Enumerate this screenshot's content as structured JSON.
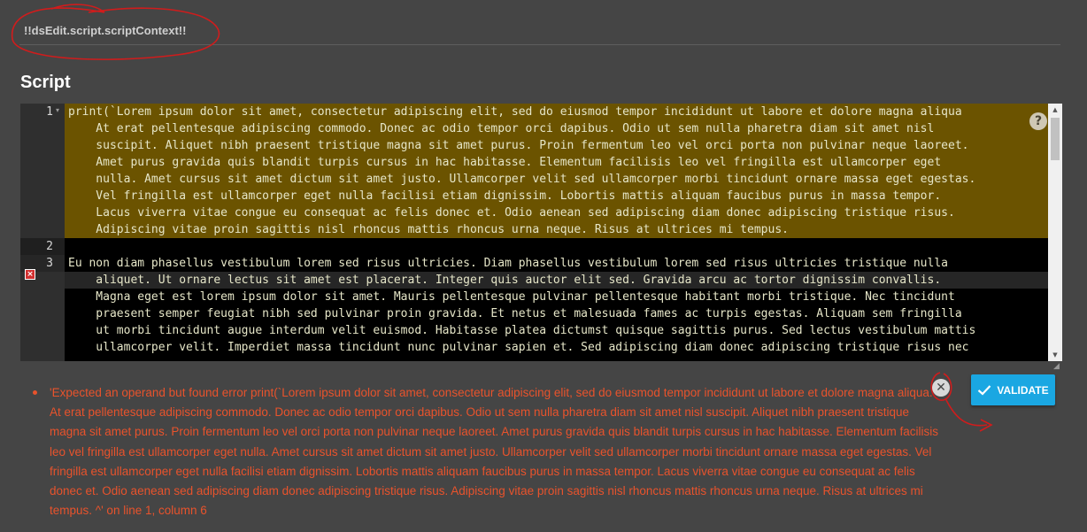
{
  "header": {
    "context": "!!dsEdit.script.scriptContext!!"
  },
  "section": {
    "title": "Script"
  },
  "editor": {
    "line_numbers": [
      "1",
      "2",
      "3"
    ],
    "lines": [
      "print(`Lorem ipsum dolor sit amet, consectetur adipiscing elit, sed do eiusmod tempor incididunt ut labore et dolore magna aliqua\n    At erat pellentesque adipiscing commodo. Donec ac odio tempor orci dapibus. Odio ut sem nulla pharetra diam sit amet nisl\n    suscipit. Aliquet nibh praesent tristique magna sit amet purus. Proin fermentum leo vel orci porta non pulvinar neque laoreet.\n    Amet purus gravida quis blandit turpis cursus in hac habitasse. Elementum facilisis leo vel fringilla est ullamcorper eget\n    nulla. Amet cursus sit amet dictum sit amet justo. Ullamcorper velit sed ullamcorper morbi tincidunt ornare massa eget egestas.\n    Vel fringilla est ullamcorper eget nulla facilisi etiam dignissim. Lobortis mattis aliquam faucibus purus in massa tempor.\n    Lacus viverra vitae congue eu consequat ac felis donec et. Odio aenean sed adipiscing diam donec adipiscing tristique risus.\n    Adipiscing vitae proin sagittis nisl rhoncus mattis rhoncus urna neque. Risus at ultrices mi tempus.",
      "",
      "Eu non diam phasellus vestibulum lorem sed risus ultricies. Diam phasellus vestibulum lorem sed risus ultricies tristique nulla\n    aliquet. Ut ornare lectus sit amet est placerat. Integer quis auctor elit sed. Gravida arcu ac tortor dignissim convallis.\n    Magna eget est lorem ipsum dolor sit amet. Mauris pellentesque pulvinar pellentesque habitant morbi tristique. Nec tincidunt\n    praesent semper feugiat nibh sed pulvinar proin gravida. Et netus et malesuada fames ac turpis egestas. Aliquam sem fringilla\n    ut morbi tincidunt augue interdum velit euismod. Habitasse platea dictumst quisque sagittis purus. Sed lectus vestibulum mattis\n    ullamcorper velit. Imperdiet massa tincidunt nunc pulvinar sapien et. Sed adipiscing diam donec adipiscing tristique risus nec"
    ],
    "fold_glyph": "▾",
    "error_marker": "×",
    "help_glyph": "?",
    "colors": {
      "error_highlight": "#6b5300",
      "gutter": "#2f2f2f",
      "background": "#000000"
    }
  },
  "errors": {
    "items": [
      "'Expected an operand but found error print(`Lorem ipsum dolor sit amet, consectetur adipiscing elit, sed do eiusmod tempor incididunt ut labore et dolore magna aliqua. At erat pellentesque adipiscing commodo. Donec ac odio tempor orci dapibus. Odio ut sem nulla pharetra diam sit amet nisl suscipit. Aliquet nibh praesent tristique magna sit amet purus. Proin fermentum leo vel orci porta non pulvinar neque laoreet. Amet purus gravida quis blandit turpis cursus in hac habitasse. Elementum facilisis leo vel fringilla est ullamcorper eget nulla. Amet cursus sit amet dictum sit amet justo. Ullamcorper velit sed ullamcorper morbi tincidunt ornare massa eget egestas. Vel fringilla est ullamcorper eget nulla facilisi etiam dignissim. Lobortis mattis aliquam faucibus purus in massa tempor. Lacus viverra vitae congue eu consequat ac felis donec et. Odio aenean sed adipiscing diam donec adipiscing tristique risus. Adipiscing vitae proin sagittis nisl rhoncus mattis rhoncus urna neque. Risus at ultrices mi tempus. ^' on line 1, column 6"
    ],
    "close_glyph": "✕",
    "color": "#e8532c"
  },
  "actions": {
    "validate_label": "Validate",
    "accent": "#1aa7e2"
  }
}
